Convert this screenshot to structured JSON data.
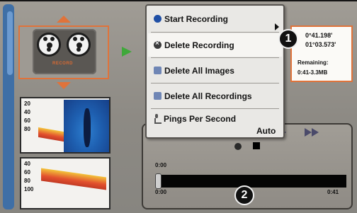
{
  "menu": {
    "items": [
      {
        "label": "Start Recording",
        "icon": "record-dot-icon"
      },
      {
        "label": "Delete Recording",
        "icon": "delete-icon"
      },
      {
        "label": "Delete All Images",
        "icon": "image-icon"
      },
      {
        "label": "Delete All Recordings",
        "icon": "recording-icon"
      },
      {
        "label": "Pings Per Second",
        "icon": "pings-icon"
      }
    ],
    "pings_value": "Auto"
  },
  "info": {
    "lat": "0°41.198'",
    "lon": "01°03.573'",
    "remaining_label": "Remaining:",
    "remaining_value": "0:41-3.3MB"
  },
  "callouts": [
    "1",
    "2"
  ],
  "thumbnails": {
    "top_scale": [
      "20",
      "40",
      "60",
      "80"
    ],
    "bottom_scale": [
      "40",
      "60",
      "80",
      "100"
    ]
  },
  "playback": {
    "time_top": "0:00",
    "time_start": "0:00",
    "time_end": "0:41",
    "position_fraction": 0.0
  },
  "deck_label": "RECORD",
  "colors": {
    "accent": "#e0733a",
    "arrow": "#3fa83a",
    "menu_bg": "#e9e8e5"
  }
}
